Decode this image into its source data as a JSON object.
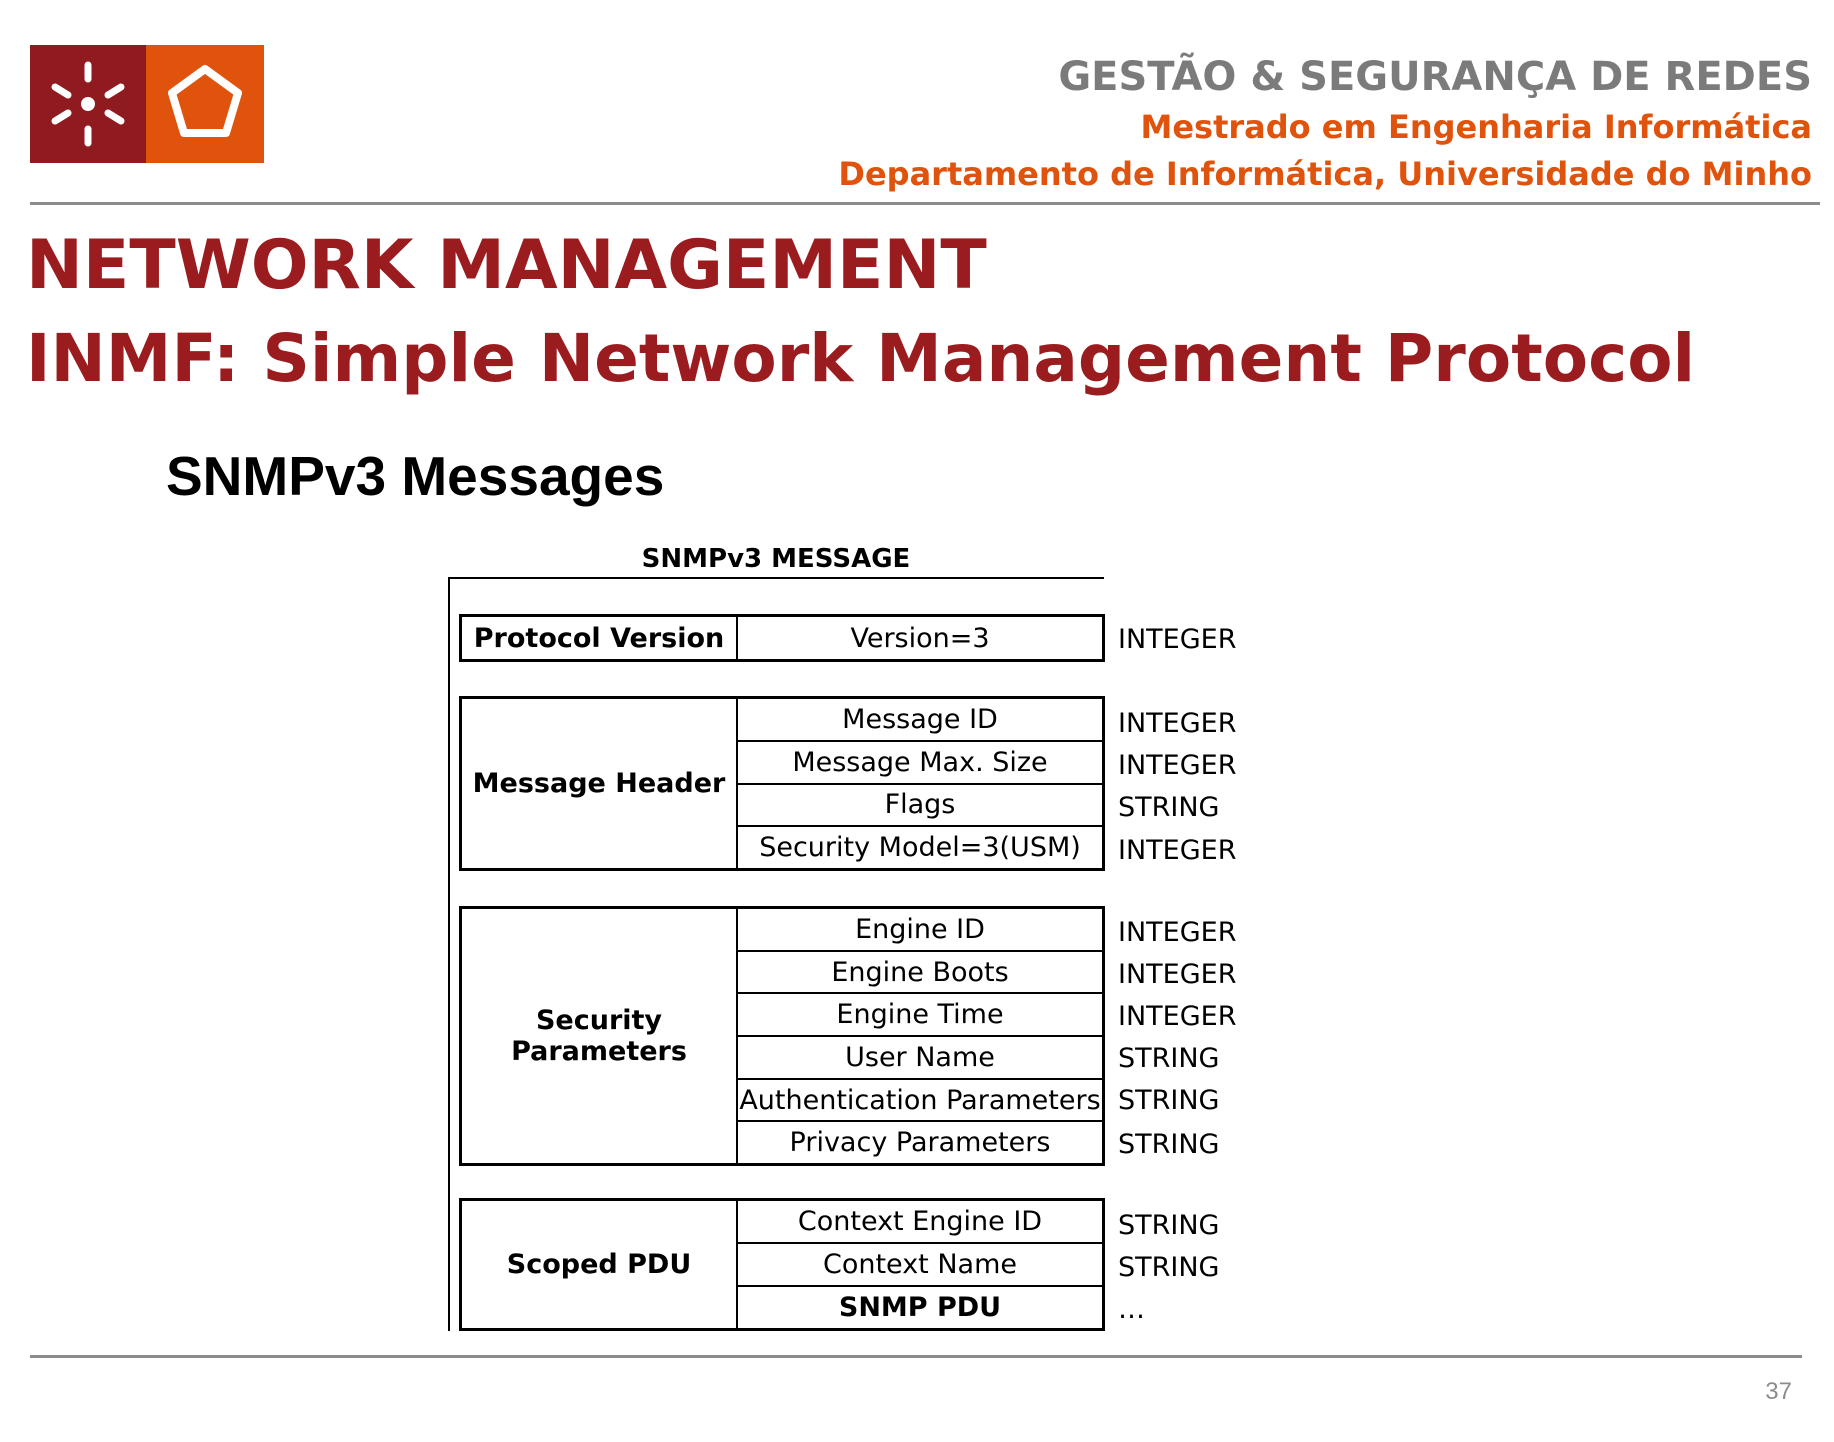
{
  "header": {
    "course": "GESTÃO & SEGURANÇA DE REDES",
    "degree": "Mestrado em Engenharia Informática",
    "department": "Departamento de Informática,  Universidade do Minho"
  },
  "logo": {
    "left_icon": "star-burst-icon",
    "right_icon": "pentagon-icon",
    "colors": [
      "#8f1a1f",
      "#e0530c"
    ]
  },
  "title": {
    "line1": "NETWORK MANAGEMENT",
    "line2": "INMF: Simple Network Management Protocol"
  },
  "subtitle": "SNMPv3 Messages",
  "diagram": {
    "title": "SNMPv3 MESSAGE",
    "groups": [
      {
        "label": "Protocol Version",
        "fields": [
          {
            "name": "Version=3",
            "type": "INTEGER"
          }
        ]
      },
      {
        "label": "Message Header",
        "fields": [
          {
            "name": "Message ID",
            "type": "INTEGER"
          },
          {
            "name": "Message Max. Size",
            "type": "INTEGER"
          },
          {
            "name": "Flags",
            "type": "STRING"
          },
          {
            "name": "Security Model=3(USM)",
            "type": "INTEGER"
          }
        ]
      },
      {
        "label": "Security Parameters",
        "fields": [
          {
            "name": "Engine ID",
            "type": "INTEGER"
          },
          {
            "name": "Engine Boots",
            "type": "INTEGER"
          },
          {
            "name": "Engine Time",
            "type": "INTEGER"
          },
          {
            "name": "User Name",
            "type": "STRING"
          },
          {
            "name": "Authentication Parameters",
            "type": "STRING"
          },
          {
            "name": "Privacy Parameters",
            "type": "STRING"
          }
        ]
      },
      {
        "label": "Scoped PDU",
        "fields": [
          {
            "name": "Context Engine ID",
            "type": "STRING"
          },
          {
            "name": "Context Name",
            "type": "STRING"
          },
          {
            "name": "SNMP PDU",
            "type": "…"
          }
        ]
      }
    ]
  },
  "page_number": "37",
  "colors": {
    "accent_red": "#9b1c1f",
    "accent_orange": "#e0530c",
    "header_gray": "#7b7b7b"
  }
}
